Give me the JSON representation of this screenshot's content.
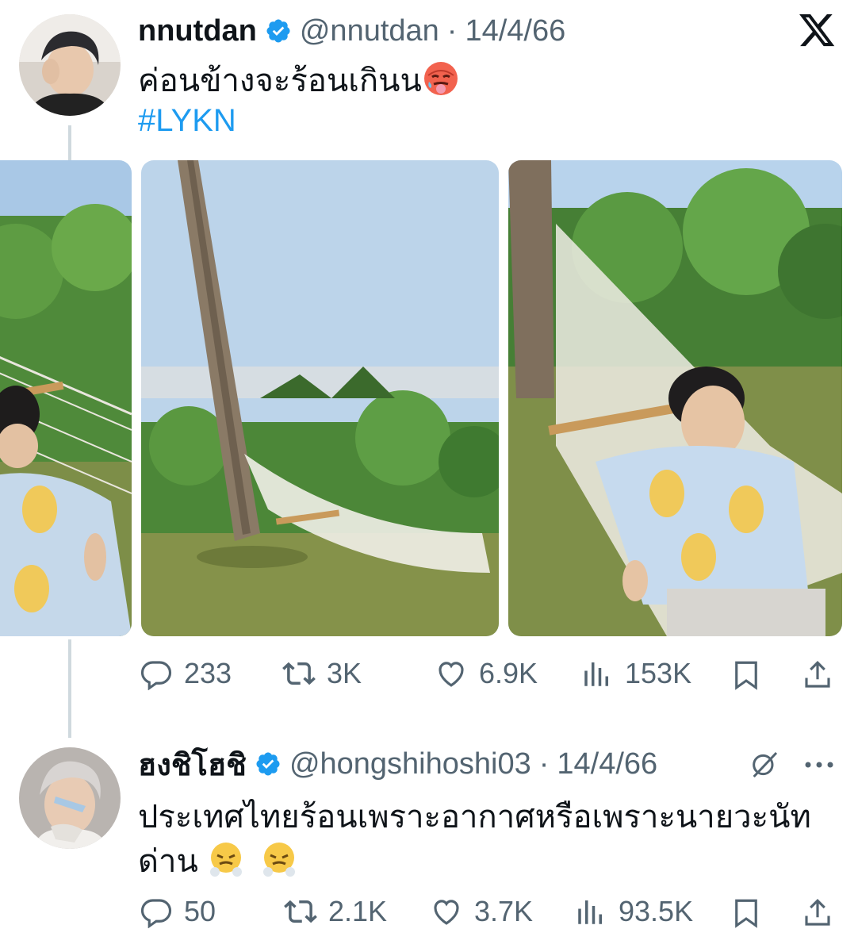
{
  "tweets": [
    {
      "display_name": "nnutdan",
      "handle": "@nnutdan",
      "date": "14/4/66",
      "text": "ค่อนข้างจะร้อนเกินน",
      "hashtag": "#LYKN",
      "emoji": "hot-face-icon",
      "stats": {
        "replies": "233",
        "retweets": "3K",
        "likes": "6.9K",
        "views": "153K"
      }
    },
    {
      "display_name": "ฮงชิโฮชิ",
      "handle": "@hongshihoshi03",
      "date": "14/4/66",
      "text_line1": "ประเทศไทยร้อนเพราะอากาศหรือเพราะนายวะนัท",
      "text_line2": "ด่าน",
      "emoji": "face-with-steam-from-nose-icon",
      "stats": {
        "replies": "50",
        "retweets": "2.1K",
        "likes": "3.7K",
        "views": "93.5K"
      }
    }
  ],
  "colors": {
    "accent": "#1d9bf0",
    "muted": "#536471",
    "text": "#0f1419",
    "verified": "#1d9bf0"
  },
  "icons": [
    "x-logo-icon",
    "verified-badge-icon",
    "reply-icon",
    "retweet-icon",
    "like-icon",
    "views-icon",
    "bookmark-icon",
    "share-icon",
    "grok-icon",
    "more-icon"
  ]
}
